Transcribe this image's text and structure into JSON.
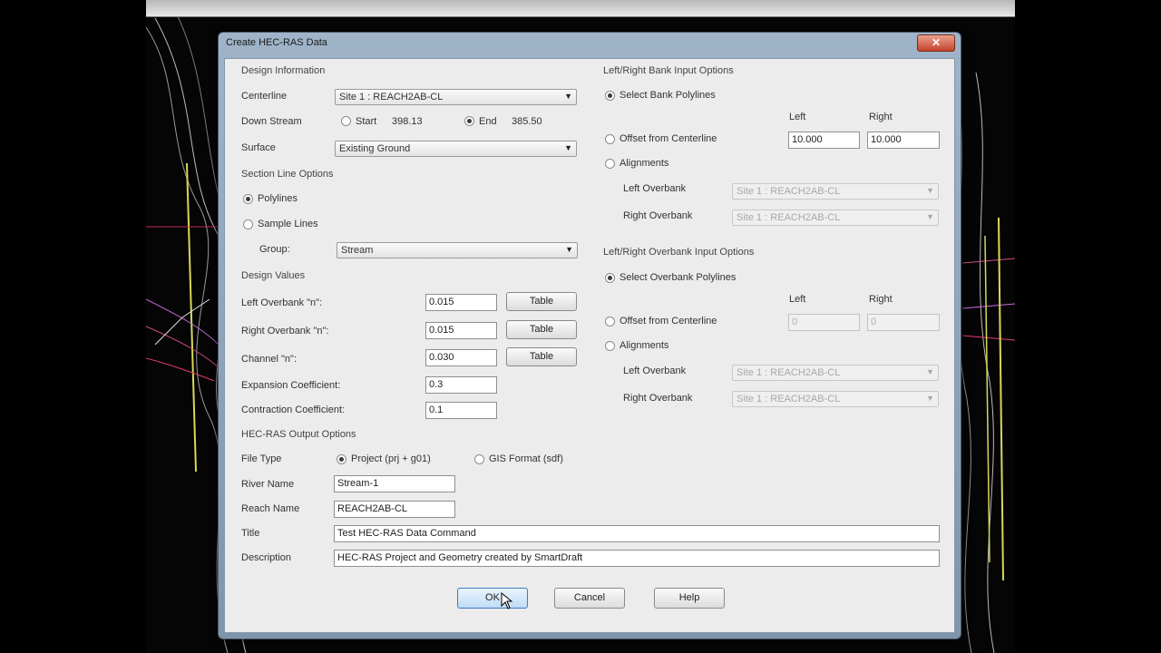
{
  "dialog": {
    "title": "Create HEC-RAS Data",
    "close_glyph": "✕"
  },
  "design_info": {
    "header": "Design Information",
    "centerline_label": "Centerline",
    "centerline_value": "Site 1 : REACH2AB-CL",
    "downstream_label": "Down Stream",
    "start_label": "Start",
    "start_value": "398.13",
    "end_label": "End",
    "end_value": "385.50",
    "downstream_selected": "End",
    "surface_label": "Surface",
    "surface_value": "Existing Ground"
  },
  "section_line": {
    "header": "Section Line Options",
    "polylines_label": "Polylines",
    "sample_lines_label": "Sample Lines",
    "selected": "Polylines",
    "group_label": "Group:",
    "group_value": "Stream"
  },
  "design_values": {
    "header": "Design Values",
    "left_overbank_label": "Left Overbank \"n\":",
    "left_overbank_value": "0.015",
    "right_overbank_label": "Right Overbank \"n\":",
    "right_overbank_value": "0.015",
    "channel_label": "Channel \"n\":",
    "channel_value": "0.030",
    "table_label": "Table",
    "expansion_label": "Expansion Coefficient:",
    "expansion_value": "0.3",
    "contraction_label": "Contraction Coefficient:",
    "contraction_value": "0.1"
  },
  "output": {
    "header": "HEC-RAS Output Options",
    "file_type_label": "File Type",
    "project_label": "Project (prj + g01)",
    "gis_label": "GIS Format (sdf)",
    "selected": "Project (prj + g01)",
    "river_name_label": "River Name",
    "river_name_value": "Stream-1",
    "reach_name_label": "Reach Name",
    "reach_name_value": "REACH2AB-CL",
    "title_label": "Title",
    "title_value": "Test HEC-RAS Data Command",
    "description_label": "Description",
    "description_value": "HEC-RAS Project and Geometry created by SmartDraft"
  },
  "bank_input": {
    "header": "Left/Right Bank Input Options",
    "select_polylines_label": "Select Bank Polylines",
    "offset_label": "Offset from Centerline",
    "alignments_label": "Alignments",
    "selected": "Select Bank Polylines",
    "left_col": "Left",
    "right_col": "Right",
    "left_value": "10.000",
    "right_value": "10.000",
    "left_overbank_label": "Left Overbank",
    "left_overbank_value": "Site 1 : REACH2AB-CL",
    "right_overbank_label": "Right Overbank",
    "right_overbank_value": "Site 1 : REACH2AB-CL"
  },
  "overbank_input": {
    "header": "Left/Right Overbank Input Options",
    "select_polylines_label": "Select Overbank Polylines",
    "offset_label": "Offset from Centerline",
    "alignments_label": "Alignments",
    "selected": "Select Overbank Polylines",
    "left_col": "Left",
    "right_col": "Right",
    "left_value": "0",
    "right_value": "0",
    "left_overbank_label": "Left Overbank",
    "left_overbank_value": "Site 1 : REACH2AB-CL",
    "right_overbank_label": "Right Overbank",
    "right_overbank_value": "Site 1 : REACH2AB-CL"
  },
  "buttons": {
    "ok": "OK",
    "cancel": "Cancel",
    "help": "Help"
  },
  "icons": {
    "dropdown": "▼",
    "close": "close-icon"
  }
}
